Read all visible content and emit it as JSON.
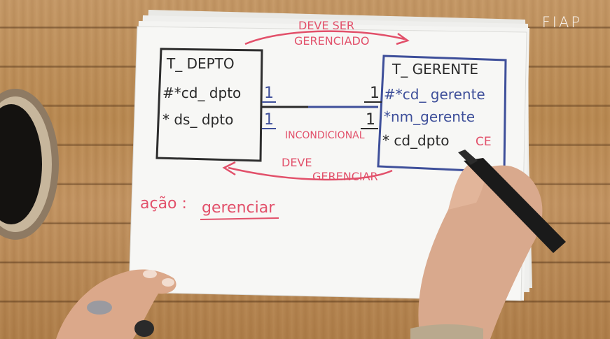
{
  "logo": {
    "text": "FIAP"
  },
  "entity_left": {
    "title": "T_ DEPTO",
    "attr1": "#*cd_ dpto",
    "attr2": "* ds_ dpto",
    "cardinality": "1"
  },
  "entity_right": {
    "title": "T_ GERENTE",
    "attr1": "#*cd_ gerente",
    "attr2": "*nm_gerente",
    "attr3": "* cd_dpto",
    "attr3_suffix": "CE",
    "cardinality": "1"
  },
  "relationship": {
    "top_label_line1": "DEVE SER",
    "top_label_line2": "GERENCIADO",
    "middle_label": "INCONDICIONAL",
    "bottom_label_line1": "DEVE",
    "bottom_label_line2": "GERENCIAR"
  },
  "action_note": {
    "prefix": "ação :",
    "verb": "gerenciar"
  },
  "colors": {
    "black_ink": "#2a2a2a",
    "red_ink": "#e2506a",
    "blue_ink": "#3e4f9a",
    "paper": "#f6f6f4",
    "wood": "#b9864f"
  }
}
